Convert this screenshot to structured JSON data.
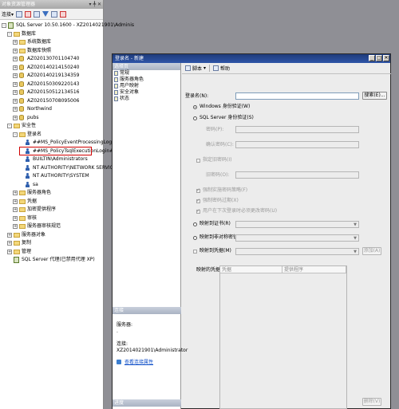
{
  "object_explorer": {
    "title": "对象资源管理器",
    "pin": "▾ ╇ ✕",
    "toolbar_label": "连接▾",
    "tree": [
      {
        "text": "SQL Server 10.50.1600 - XZ2014021901\\Adminis",
        "icon": "server-icon",
        "indent": 0,
        "exp": "-"
      },
      {
        "text": "数据库",
        "icon": "folder-icon",
        "indent": 1,
        "exp": "-"
      },
      {
        "text": "系统数据库",
        "icon": "folder-icon",
        "indent": 2,
        "exp": "+"
      },
      {
        "text": "数据库快照",
        "icon": "folder-icon",
        "indent": 2,
        "exp": "+"
      },
      {
        "text": "AZ020130701104740",
        "icon": "database-icon",
        "indent": 2,
        "exp": "+"
      },
      {
        "text": "AZ020140214150240",
        "icon": "database-icon",
        "indent": 2,
        "exp": "+"
      },
      {
        "text": "AZ020140219134359",
        "icon": "database-icon",
        "indent": 2,
        "exp": "+"
      },
      {
        "text": "AZ020150309220143",
        "icon": "database-icon",
        "indent": 2,
        "exp": "+"
      },
      {
        "text": "AZ020150512134516",
        "icon": "database-icon",
        "indent": 2,
        "exp": "+"
      },
      {
        "text": "AZ020150708095006",
        "icon": "database-icon",
        "indent": 2,
        "exp": "+"
      },
      {
        "text": "Northwind",
        "icon": "database-icon",
        "indent": 2,
        "exp": "+"
      },
      {
        "text": "pubs",
        "icon": "database-icon",
        "indent": 2,
        "exp": "+"
      },
      {
        "text": "安全性",
        "icon": "folder-icon",
        "indent": 1,
        "exp": "-"
      },
      {
        "text": "登录名",
        "icon": "folder-icon",
        "indent": 2,
        "exp": "-"
      },
      {
        "text": "##MS_PolicyEventProcessingLogin##",
        "icon": "user-icon",
        "indent": 3,
        "exp": ""
      },
      {
        "text": "##MS_PolicyTsqlExecutionLogin##",
        "icon": "user-icon",
        "indent": 3,
        "exp": ""
      },
      {
        "text": "BUILTIN\\Administrators",
        "icon": "user-icon",
        "indent": 3,
        "exp": ""
      },
      {
        "text": "NT AUTHORITY\\NETWORK SERVICE",
        "icon": "user-icon",
        "indent": 3,
        "exp": ""
      },
      {
        "text": "NT AUTHORITY\\SYSTEM",
        "icon": "user-icon",
        "indent": 3,
        "exp": ""
      },
      {
        "text": "sa",
        "icon": "user-icon",
        "indent": 3,
        "exp": ""
      },
      {
        "text": "服务器角色",
        "icon": "folder-icon",
        "indent": 2,
        "exp": "+"
      },
      {
        "text": "凭据",
        "icon": "folder-icon",
        "indent": 2,
        "exp": "+"
      },
      {
        "text": "加密提供程序",
        "icon": "folder-icon",
        "indent": 2,
        "exp": "+"
      },
      {
        "text": "审核",
        "icon": "folder-icon",
        "indent": 2,
        "exp": "+"
      },
      {
        "text": "服务器审核规范",
        "icon": "folder-icon",
        "indent": 2,
        "exp": "+"
      },
      {
        "text": "服务器对象",
        "icon": "folder-icon",
        "indent": 1,
        "exp": "+"
      },
      {
        "text": "复制",
        "icon": "folder-icon",
        "indent": 1,
        "exp": "+"
      },
      {
        "text": "管理",
        "icon": "folder-icon",
        "indent": 1,
        "exp": "+"
      },
      {
        "text": "SQL Server 代理(已禁用代理 XP)",
        "icon": "agent-icon",
        "indent": 1,
        "exp": ""
      }
    ]
  },
  "dialog": {
    "title": "登录名 - 新建",
    "select_page_header": "选择页",
    "pages": [
      "常规",
      "服务器角色",
      "用户映射",
      "安全对象",
      "状态"
    ],
    "connection_header": "连接",
    "server_label": "服务器:",
    "server_value": ".",
    "connection_label": "连接:",
    "connection_value": "XZ2014021901\\Administrator",
    "view_props_link": "查看连接属性",
    "progress_header": "进度",
    "toolbar": {
      "script": "脚本",
      "help": "帮助"
    },
    "form": {
      "login_name_label": "登录名(N):",
      "search_button": "搜索(E)...",
      "windows_auth": "Windows 身份验证(W)",
      "sql_auth": "SQL Server 身份验证(S)",
      "password_label": "密码(P):",
      "confirm_password_label": "确认密码(C):",
      "specify_old_password": "指定旧密码(I)",
      "old_password_label": "旧密码(O):",
      "enforce_policy": "强制实施密码策略(F)",
      "enforce_expiration": "强制密码过期(X)",
      "must_change": "用户在下次登录时必须更改密码(U)",
      "cert_mapped": "映射到证书(R)",
      "asym_key_mapped": "映射到非对称密钥(T)",
      "map_to_credential": "映射到凭据(M)",
      "add_button": "添加(A)",
      "mapped_credentials_label": "映射的凭据",
      "grid_columns": [
        "凭据",
        "提供程序"
      ],
      "remove_button": "删除(V)"
    }
  }
}
